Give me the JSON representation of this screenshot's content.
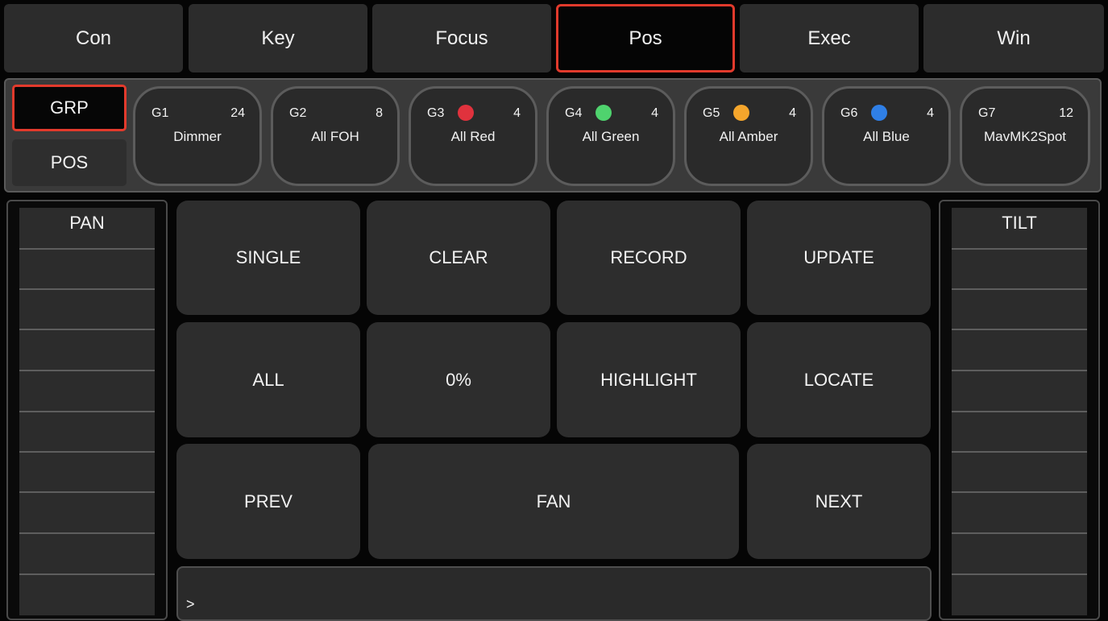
{
  "tabs": [
    {
      "label": "Con",
      "active": false
    },
    {
      "label": "Key",
      "active": false
    },
    {
      "label": "Focus",
      "active": false
    },
    {
      "label": "Pos",
      "active": true
    },
    {
      "label": "Exec",
      "active": false
    },
    {
      "label": "Win",
      "active": false
    }
  ],
  "modes": {
    "grp": "GRP",
    "pos": "POS"
  },
  "groups": [
    {
      "id": "G1",
      "count": "24",
      "name": "Dimmer",
      "color": null
    },
    {
      "id": "G2",
      "count": "8",
      "name": "All FOH",
      "color": null
    },
    {
      "id": "G3",
      "count": "4",
      "name": "All Red",
      "color": "#e0323d"
    },
    {
      "id": "G4",
      "count": "4",
      "name": "All Green",
      "color": "#4fd36e"
    },
    {
      "id": "G5",
      "count": "4",
      "name": "All Amber",
      "color": "#f5a62c"
    },
    {
      "id": "G6",
      "count": "4",
      "name": "All Blue",
      "color": "#2f7fe6"
    },
    {
      "id": "G7",
      "count": "12",
      "name": "MavMK2Spot",
      "color": null
    }
  ],
  "faders": {
    "pan": "PAN",
    "tilt": "TILT"
  },
  "buttons": {
    "single": "SINGLE",
    "clear": "CLEAR",
    "record": "RECORD",
    "update": "UPDATE",
    "all": "ALL",
    "zero": "0%",
    "highlight": "HIGHLIGHT",
    "locate": "LOCATE",
    "prev": "PREV",
    "fan": "FAN",
    "next": "NEXT"
  },
  "command_line": {
    "prompt": ">"
  },
  "colors": {
    "accent": "#e23a2c",
    "button": "#2d2d2d",
    "background": "#050505"
  }
}
